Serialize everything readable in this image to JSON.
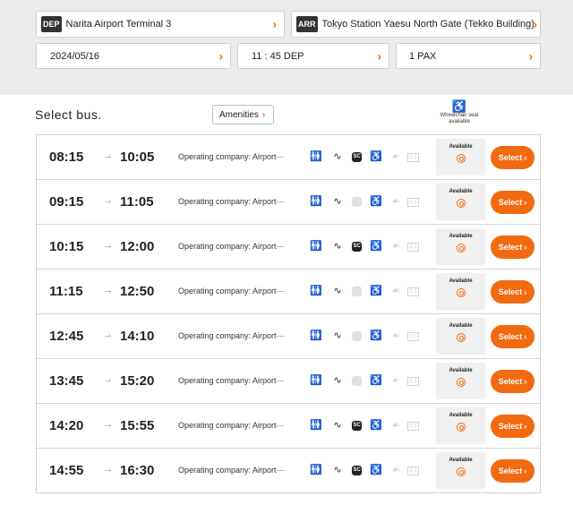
{
  "search": {
    "dep_tag": "DEP",
    "departure": "Narita Airport Terminal 3",
    "arr_tag": "ARR",
    "arrival": "Tokyo Station Yaesu North Gate (Tekko Building)",
    "date": "2024/05/16",
    "time": "11 : 45 DEP",
    "pax": "1 PAX",
    "chevron": "›"
  },
  "list": {
    "title": "Select bus.",
    "amenities_label": "Amenities",
    "wheelchair_label": "Wheelchair seat available",
    "wheelchair_icon": "wheelchair-icon",
    "arrow_glyph": "→",
    "available_label": "Available",
    "select_label": "Select",
    "sc_label": "SC"
  },
  "colors": {
    "accent": "#f26a10",
    "topbar": "#ebebeb"
  },
  "rows": [
    {
      "dep": "08:15",
      "arr": "10:05",
      "operator": "Operating company: Airport⋯",
      "sc": true
    },
    {
      "dep": "09:15",
      "arr": "11:05",
      "operator": "Operating company: Airport⋯",
      "sc": false
    },
    {
      "dep": "10:15",
      "arr": "12:00",
      "operator": "Operating company: Airport⋯",
      "sc": true
    },
    {
      "dep": "11:15",
      "arr": "12:50",
      "operator": "Operating company: Airport⋯",
      "sc": false
    },
    {
      "dep": "12:45",
      "arr": "14:10",
      "operator": "Operating company: Airport⋯",
      "sc": false
    },
    {
      "dep": "13:45",
      "arr": "15:20",
      "operator": "Operating company: Airport⋯",
      "sc": false
    },
    {
      "dep": "14:20",
      "arr": "15:55",
      "operator": "Operating company: Airport⋯",
      "sc": true
    },
    {
      "dep": "14:55",
      "arr": "16:30",
      "operator": "Operating company: Airport⋯",
      "sc": true
    }
  ]
}
